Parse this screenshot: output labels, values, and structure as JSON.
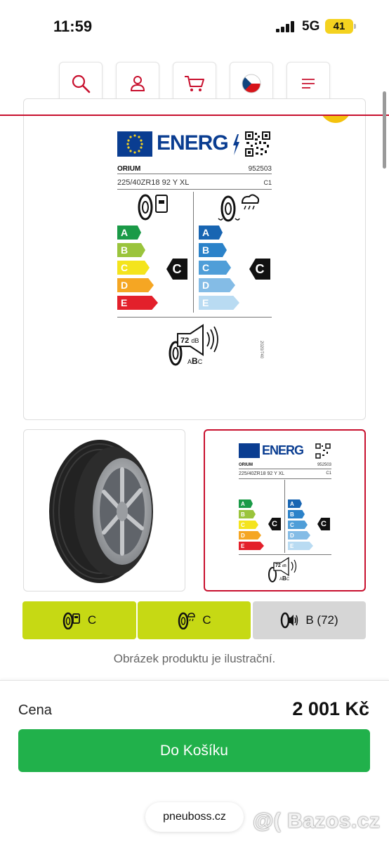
{
  "status_bar": {
    "time": "11:59",
    "network": "5G",
    "battery": "41"
  },
  "nav": {
    "icons": [
      "search-icon",
      "user-icon",
      "cart-icon",
      "czech-flag-icon",
      "menu-icon"
    ]
  },
  "energy_label": {
    "title": "ENERG",
    "brand": "ORIUM",
    "article_number": "952503",
    "tyre_size": "225/40ZR18 92 Y XL",
    "tyre_class": "C1",
    "fuel_scale": [
      "A",
      "B",
      "C",
      "D",
      "E"
    ],
    "wet_scale": [
      "A",
      "B",
      "C",
      "D",
      "E"
    ],
    "fuel_grade": "C",
    "wet_grade": "C",
    "noise_db": "72",
    "noise_unit": "dB",
    "noise_classes": [
      "A",
      "B",
      "C"
    ],
    "regulation": "2020/740",
    "colors": {
      "eu_blue": "#0a3d91",
      "fuel_bars": [
        "#1a9a47",
        "#9ac43c",
        "#f4e41d",
        "#f5a623",
        "#e3202b"
      ],
      "wet_bars": [
        "#1865b2",
        "#2b82c9",
        "#4f9ed8",
        "#84bce6",
        "#b9dbf2"
      ]
    }
  },
  "badges": [
    {
      "icon": "fuel-tyre-icon",
      "value": "C",
      "color": "#c6d914"
    },
    {
      "icon": "wet-tyre-icon",
      "value": "C",
      "color": "#c6d914"
    },
    {
      "icon": "noise-tyre-icon",
      "value": "B (72)",
      "color": "#d6d6d6"
    }
  ],
  "note": "Obrázek produktu je ilustrační.",
  "price": {
    "label": "Cena",
    "value": "2 001 Kč"
  },
  "cta_label": "Do Košíku",
  "site_domain": "pneuboss.cz",
  "watermark": "@( Bazos.cz"
}
